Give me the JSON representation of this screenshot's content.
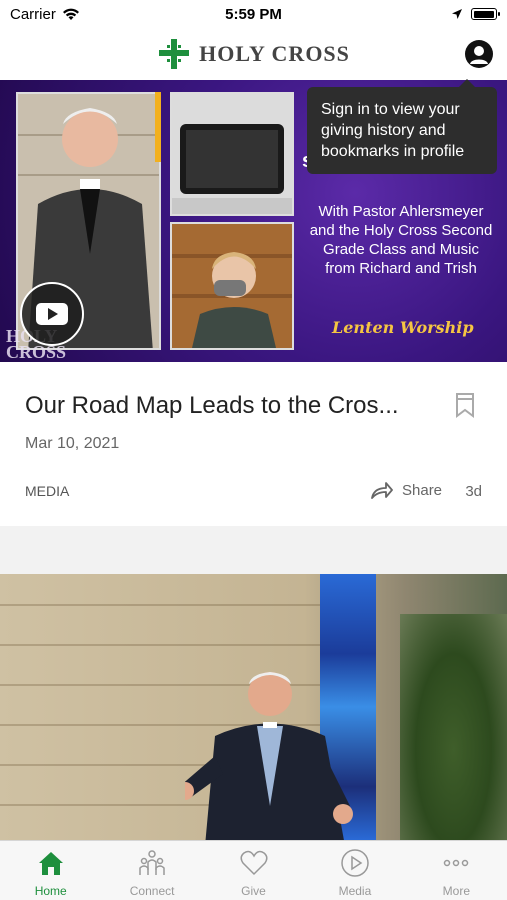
{
  "status": {
    "carrier": "Carrier",
    "time": "5:59 PM"
  },
  "header": {
    "brand": "HOLY CROSS"
  },
  "tooltip": {
    "text": "Sign in to view your giving history and bookmarks in profile"
  },
  "card": {
    "hero": {
      "partial_title": "s",
      "subtitle": "With Pastor Ahlersmeyer and the Holy Cross Second Grade Class and Music from Richard and Trish",
      "script": "Lenten Worship",
      "logo_line1": "HOLY",
      "logo_line2": "CROSS"
    },
    "title": "Our Road Map Leads to the Cros...",
    "date": "Mar 10, 2021",
    "category": "MEDIA",
    "share_label": "Share",
    "age": "3d"
  },
  "tabs": [
    {
      "label": "Home",
      "icon": "home-icon",
      "active": true
    },
    {
      "label": "Connect",
      "icon": "people-icon",
      "active": false
    },
    {
      "label": "Give",
      "icon": "heart-icon",
      "active": false
    },
    {
      "label": "Media",
      "icon": "play-circle-icon",
      "active": false
    },
    {
      "label": "More",
      "icon": "ellipsis-icon",
      "active": false
    }
  ],
  "colors": {
    "accent": "#1e8f3d",
    "hero_purple": "#3a1680",
    "gold": "#f5c542"
  }
}
